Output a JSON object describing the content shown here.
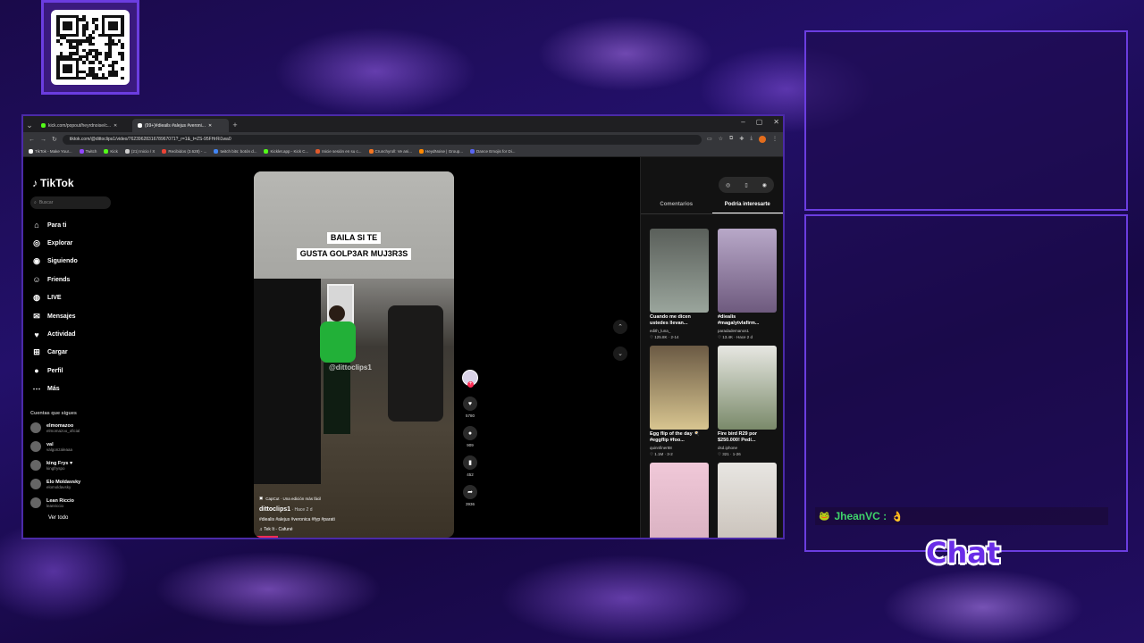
{
  "browser": {
    "tabs": [
      {
        "label": "kick.com/popout/heyrdnoise/c..."
      },
      {
        "label": "(99+)#dieails #alejus #veroni..."
      }
    ],
    "url": "tiktok.com/@dittoclips1/video/7623962831678967071?_r=1&_t=ZS-95FHrRi1wa0",
    "bookmarks": [
      {
        "label": "TikTok - Make Your...",
        "color": "#ffffff"
      },
      {
        "label": "Twitch",
        "color": "#9146ff"
      },
      {
        "label": "Kick",
        "color": "#53fc18"
      },
      {
        "label": "(21) Inicio / X",
        "color": "#cccccc"
      },
      {
        "label": "Recibidos (3.628) - ...",
        "color": "#ea4335"
      },
      {
        "label": "twitch bits: botón d...",
        "color": "#4285f4"
      },
      {
        "label": "Kicklet.app - Kick C...",
        "color": "#53fc18"
      },
      {
        "label": "Inicie sesión en su c...",
        "color": "#e05a2b"
      },
      {
        "label": "Crunchyroll: Ve ani...",
        "color": "#f47521"
      },
      {
        "label": "HeydNoise | Group...",
        "color": "#ff8800"
      },
      {
        "label": "Dance Emojis for Di...",
        "color": "#5865f2"
      }
    ]
  },
  "tiktok": {
    "logo": "TikTok",
    "search_placeholder": "Buscar",
    "nav": [
      {
        "label": "Para ti",
        "icon": "home-icon"
      },
      {
        "label": "Explorar",
        "icon": "compass-icon"
      },
      {
        "label": "Siguiendo",
        "icon": "following-icon"
      },
      {
        "label": "Friends",
        "icon": "friends-icon"
      },
      {
        "label": "LIVE",
        "icon": "live-icon"
      },
      {
        "label": "Mensajes",
        "icon": "messages-icon"
      },
      {
        "label": "Actividad",
        "icon": "activity-icon"
      },
      {
        "label": "Cargar",
        "icon": "upload-icon"
      },
      {
        "label": "Perfil",
        "icon": "profile-icon"
      },
      {
        "label": "Más",
        "icon": "more-icon"
      }
    ],
    "following_title": "Cuentas que sigues",
    "following": [
      {
        "name": "elmomazoo",
        "handle": "elmomazoo_oficial"
      },
      {
        "name": "val",
        "handle": "valgonzaleaaa"
      },
      {
        "name": "king Frys ♥",
        "handle": "kingfryspo"
      },
      {
        "name": "Elo Moldavsky",
        "handle": "elomoldavsky"
      },
      {
        "name": "Lean Riccio",
        "handle": "leanriccio"
      }
    ],
    "see_all": "Ver todo",
    "video": {
      "caption_lines": [
        "BAILA SI TE",
        "GUSTA GOLP3AR MUJ3R3S"
      ],
      "watermark": "@dittoclips1",
      "capcut": "CapCut · Una edición más fácil",
      "username": "dittoclips1",
      "time": " · Hace 2 d",
      "hashtags": "#diealis #alejus #veronica #fyp #parati",
      "sound": "Tek It - Cafuné",
      "progress_fraction": 0.12
    },
    "actions": {
      "likes": "5780",
      "comments": "909",
      "saves": "452",
      "shares": "3936"
    },
    "right_tabs": [
      "Comentarios",
      "Podría interesarte"
    ],
    "recommendations": [
      {
        "title": "Cuando me dicen ustedes llevan...",
        "user": "edith_luna_",
        "stats": "♡ 125.8K · 2-14",
        "colors": [
          "#5a5f5a",
          "#9aa59c"
        ]
      },
      {
        "title": "#diealis #magalytvlafirm...",
        "user": "paradademanos1",
        "stats": "♡ 13.4K · Hace 2 d",
        "colors": [
          "#b8a8c8",
          "#6e5a7e"
        ]
      },
      {
        "title": "Egg flip of the day 🍳 #eggflip #foo...",
        "user": "quinnfiner88",
        "stats": "♡ 1.1M · 3-2",
        "colors": [
          "#6b5a44",
          "#d8c590"
        ]
      },
      {
        "title": "Fire bird R29 por $250.000! Pedí...",
        "user": "dsd.iphone",
        "stats": "♡ 321 · 1-26",
        "colors": [
          "#e7e7e2",
          "#7a8a6a"
        ]
      },
      {
        "title": "",
        "user": "",
        "stats": "",
        "colors": [
          "#f0c8d8",
          "#d8b0c0"
        ]
      },
      {
        "title": "",
        "user": "",
        "stats": "",
        "colors": [
          "#e8e6e2",
          "#c8c0b8"
        ]
      }
    ]
  },
  "overlay": {
    "chat_user": "JheanVC :",
    "chat_message": "👌",
    "chat_label": "Chat",
    "accent": "#6b3de0"
  }
}
